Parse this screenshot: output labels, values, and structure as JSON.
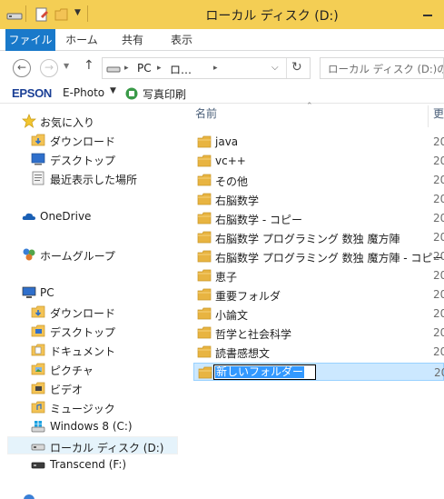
{
  "window": {
    "title": "ローカル ディスク (D:)"
  },
  "ribbon": {
    "tabs": [
      "ファイル",
      "ホーム",
      "共有",
      "表示"
    ]
  },
  "address": {
    "segments": [
      "PC",
      "ロ…"
    ],
    "search_placeholder": "ローカル ディスク (D:)の検"
  },
  "epson_toolbar": {
    "brand": "EPSON",
    "app": "E-Photo",
    "print_label": "写真印刷"
  },
  "nav": {
    "favorites": {
      "label": "お気に入り",
      "items": [
        "ダウンロード",
        "デスクトップ",
        "最近表示した場所"
      ]
    },
    "onedrive": "OneDrive",
    "homegroup": "ホームグループ",
    "pc": {
      "label": "PC",
      "items": [
        "ダウンロード",
        "デスクトップ",
        "ドキュメント",
        "ピクチャ",
        "ビデオ",
        "ミュージック",
        "Windows 8 (C:)",
        "ローカル ディスク (D:)",
        "Transcend (F:)"
      ]
    }
  },
  "content": {
    "column_name": "名前",
    "column_date_partial": "更",
    "date_prefix": "20",
    "items": [
      "java",
      "vc++",
      "その他",
      "右脳数学",
      "右脳数学 - コピー",
      "右脳数学 プログラミング 数独 魔方陣",
      "右脳数学 プログラミング 数独 魔方陣 - コピー",
      "恵子",
      "重要フォルダ",
      "小論文",
      "哲学と社会科学",
      "読書感想文"
    ],
    "renaming_item": "新しいフォルダー"
  },
  "colors": {
    "titlebar": "#f4ce54",
    "file_tab": "#1979ca",
    "selection": "#cce8ff",
    "folder": "#e8b441"
  }
}
